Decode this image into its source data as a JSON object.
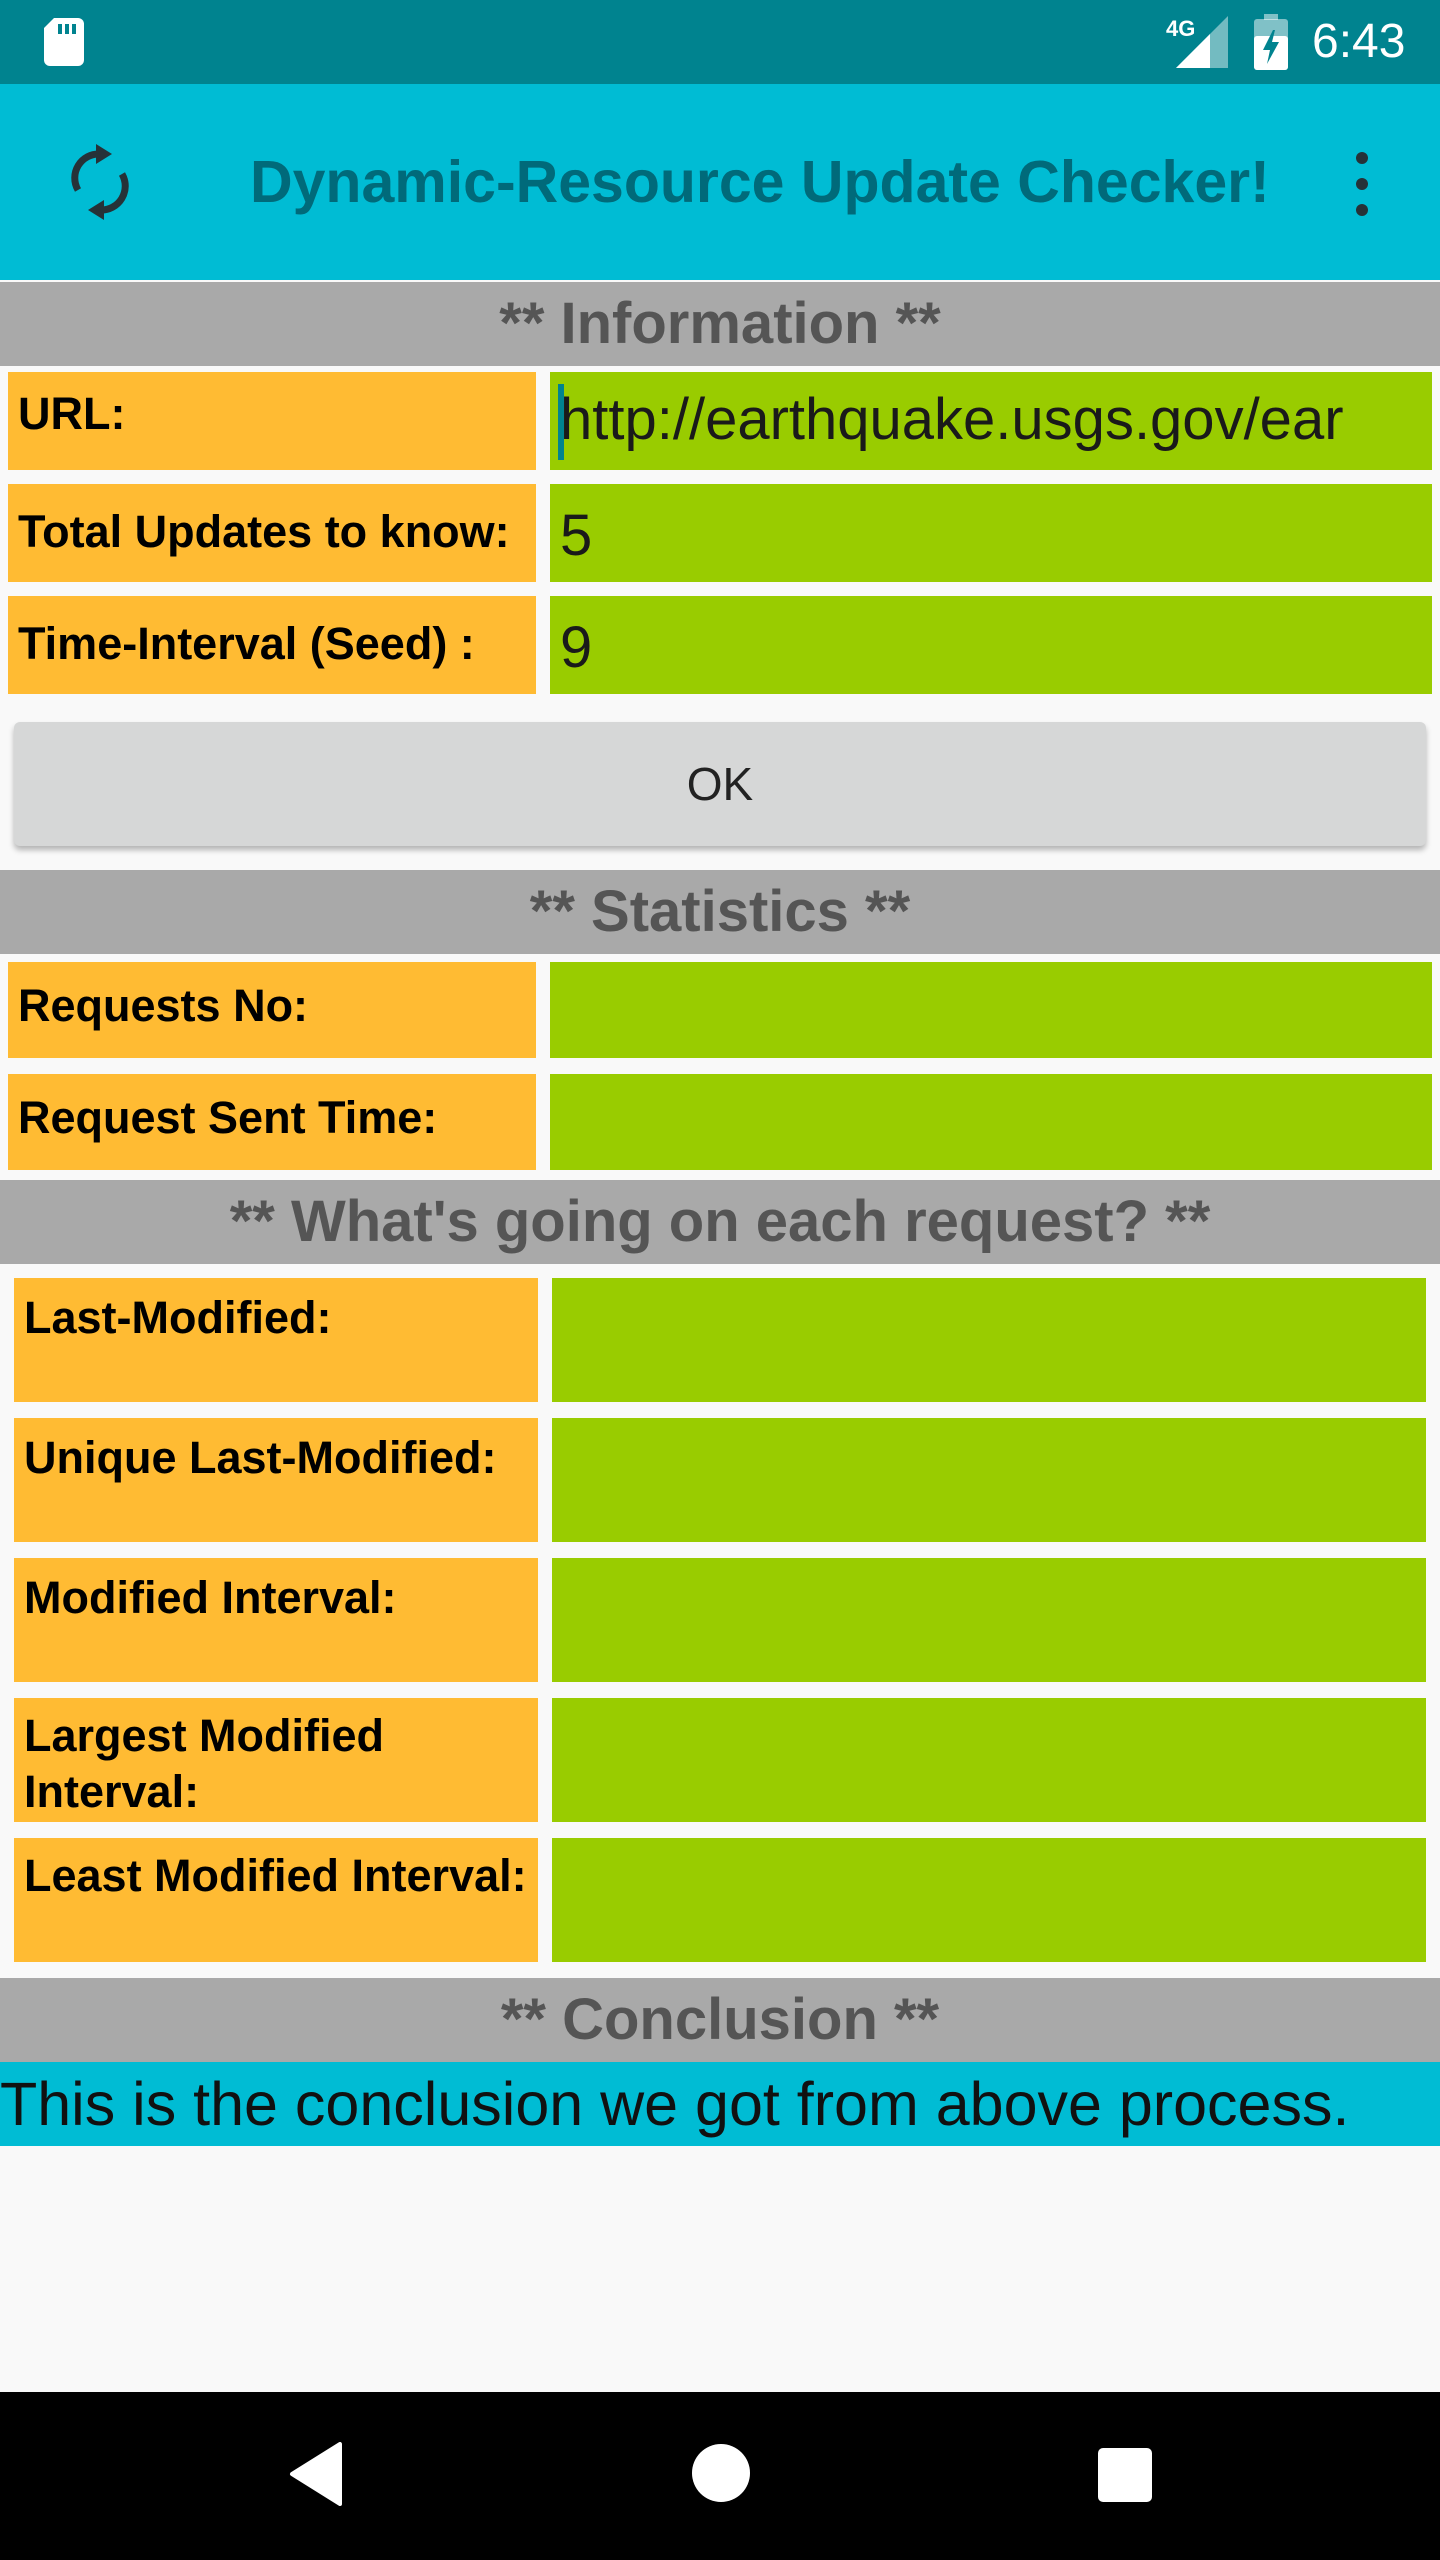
{
  "status_bar": {
    "time": "6:43",
    "network": "4G",
    "icons": [
      "sd-card-icon",
      "signal-icon",
      "battery-charging-icon"
    ]
  },
  "app_bar": {
    "title": "Dynamic-Resource Update Checker!",
    "icons": [
      "refresh-icon",
      "more-vert-icon"
    ]
  },
  "information": {
    "header": "** Information **",
    "url_label": "URL:",
    "url_value": "http://earthquake.usgs.gov/ear",
    "total_updates_label": "Total Updates to know:",
    "total_updates_value": "5",
    "time_interval_label": "Time-Interval (Seed) :",
    "time_interval_value": "9",
    "ok_label": "OK"
  },
  "statistics": {
    "header": "** Statistics **",
    "requests_no_label": "Requests No:",
    "requests_no_value": "",
    "request_sent_time_label": "Request Sent Time:",
    "request_sent_time_value": ""
  },
  "each_request": {
    "header": "** What's going on each request? **",
    "last_modified_label": "Last-Modified:",
    "last_modified_value": "",
    "unique_last_modified_label": "Unique Last-Modified:",
    "unique_last_modified_value": "",
    "modified_interval_label": "Modified Interval:",
    "modified_interval_value": "",
    "largest_modified_interval_label": "Largest Modified Interval:",
    "largest_modified_interval_value": "",
    "least_modified_interval_label": "Least Modified Interval:",
    "least_modified_interval_value": ""
  },
  "conclusion": {
    "header": "** Conclusion **",
    "text": "This is the conclusion we got from above process."
  },
  "colors": {
    "status_bar": "#00838f",
    "app_bar": "#00bcd4",
    "section_header": "#a9a9a9",
    "label_bg": "#ffbb33",
    "value_bg": "#99cc00",
    "button_bg": "#d6d7d7"
  }
}
